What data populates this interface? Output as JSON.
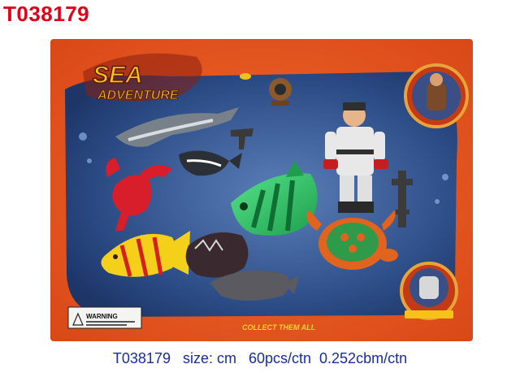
{
  "product_code": "T038179",
  "package": {
    "logo_line1": "SEA",
    "logo_line2": "ADVENTURE",
    "slogan": "COLLECT THEM ALL",
    "warning_label": "WARNING"
  },
  "caption": "T038179   size: cm   60pcs/ctn  0.252cbm/ctn"
}
